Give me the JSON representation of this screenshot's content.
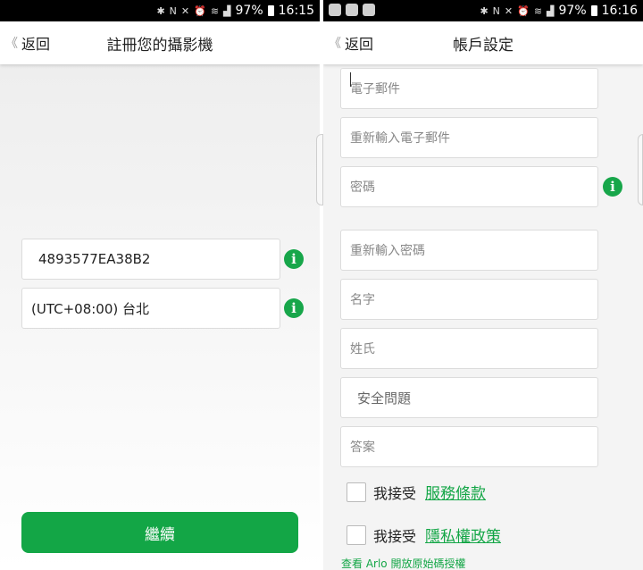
{
  "left": {
    "status": {
      "battery": "97%",
      "time": "16:15"
    },
    "nav": {
      "back_label": "返回",
      "title": "註冊您的攝影機"
    },
    "serial_value": "4893577EA38B2",
    "timezone_value": "(UTC+08:00) 台北",
    "continue_label": "繼續"
  },
  "right": {
    "status": {
      "battery": "97%",
      "time": "16:16"
    },
    "nav": {
      "back_label": "返回",
      "title": "帳戶設定"
    },
    "fields": {
      "email": "電子郵件",
      "email_confirm": "重新輸入電子郵件",
      "password": "密碼",
      "password_confirm": "重新輸入密碼",
      "first_name": "名字",
      "last_name": "姓氏",
      "security_question": "安全問題",
      "answer": "答案"
    },
    "accept_label": "我接受",
    "terms_link": "服務條款",
    "privacy_link": "隱私權政策",
    "footer_link": "查看 Arlo 開放原始碼授權"
  },
  "colors": {
    "accent": "#13a646",
    "info": "#17a64a"
  },
  "icons": [
    "back-chevron-icon",
    "info-icon",
    "bluetooth-icon",
    "nfc-icon",
    "mute-icon",
    "alarm-icon",
    "wifi-icon",
    "signal-icon",
    "battery-icon"
  ]
}
